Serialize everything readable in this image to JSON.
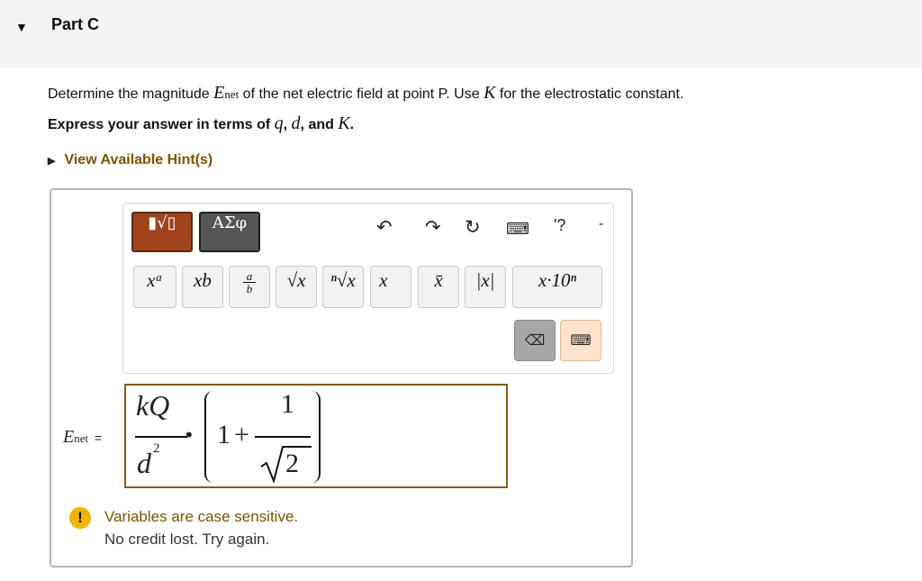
{
  "header": {
    "caret": "▼",
    "title": "Part C"
  },
  "question": {
    "p1": "Determine the magnitude ",
    "var_E": "E",
    "var_sub": "net",
    "p2": " of the net electric field at point P. Use ",
    "var_K": "K",
    "p3": " for the electrostatic constant."
  },
  "instruction": {
    "p1": "Express your answer in terms of ",
    "q": "q",
    "comma1": ", ",
    "d": "d",
    "p2": ", and ",
    "K": "K",
    "p3": "."
  },
  "hint": {
    "arrow": "▶",
    "label": "View Available Hint(s)"
  },
  "toolbar": {
    "tab1": "▮√▯",
    "tab2": "ΑΣφ",
    "undo": "↶",
    "redo": "↷",
    "reset": "↻",
    "keyboard": "⌨",
    "help": "'?",
    "dash": "-"
  },
  "keys": {
    "superscript": "xᵃ",
    "subscript": "xb",
    "fraction_num": "a",
    "fraction_den": "b",
    "sqrt": "√x",
    "nthroot": "ⁿ√x",
    "vector": "x⃗",
    "xbar": "x̄",
    "abs": "|x|",
    "sci": "x·10ⁿ",
    "delete": "⌫",
    "keyboard_toggle": "⌨"
  },
  "answer": {
    "label_E": "E",
    "label_sub": "net",
    "equals": "=",
    "num1": "kQ",
    "den1": "d",
    "den1_exp": "2",
    "dot": "•",
    "one": "1",
    "plus": "+",
    "num2": "1",
    "root_arg": "2"
  },
  "feedback": {
    "icon": "!",
    "line1": "Variables are case sensitive.",
    "line2": "No credit lost. Try again."
  }
}
